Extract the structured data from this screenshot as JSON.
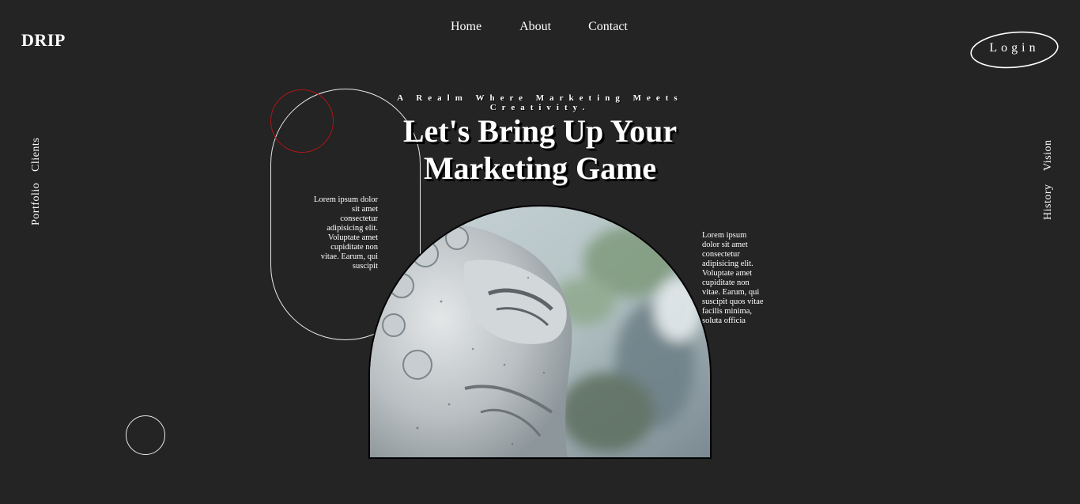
{
  "brand": {
    "logo": "DRIP"
  },
  "nav": {
    "items": [
      "Home",
      "About",
      "Contact"
    ]
  },
  "login": {
    "label": "Login"
  },
  "side_left": {
    "items": [
      "Portfolio",
      "Clients"
    ]
  },
  "side_right": {
    "items": [
      "History",
      "Vision"
    ]
  },
  "hero": {
    "tagline": "A Realm Where Marketing Meets Creativity.",
    "headline_line1": "Let's Bring Up Your",
    "headline_line2": "Marketing Game",
    "blurb_left": "Lorem ipsum dolor sit amet consectetur adipisicing elit. Voluptate amet cupiditate non vitae. Earum, qui suscipit",
    "blurb_right": "Lorem ipsum dolor sit amet consectetur adipisicing elit. Voluptate amet cupiditate non vitae. Earum, qui suscipit quos vitae facilis minima, soluta officia",
    "image_alt": "stone lion statue"
  },
  "colors": {
    "background": "#242424",
    "accent_red": "#b01515",
    "text": "#ffffff"
  }
}
